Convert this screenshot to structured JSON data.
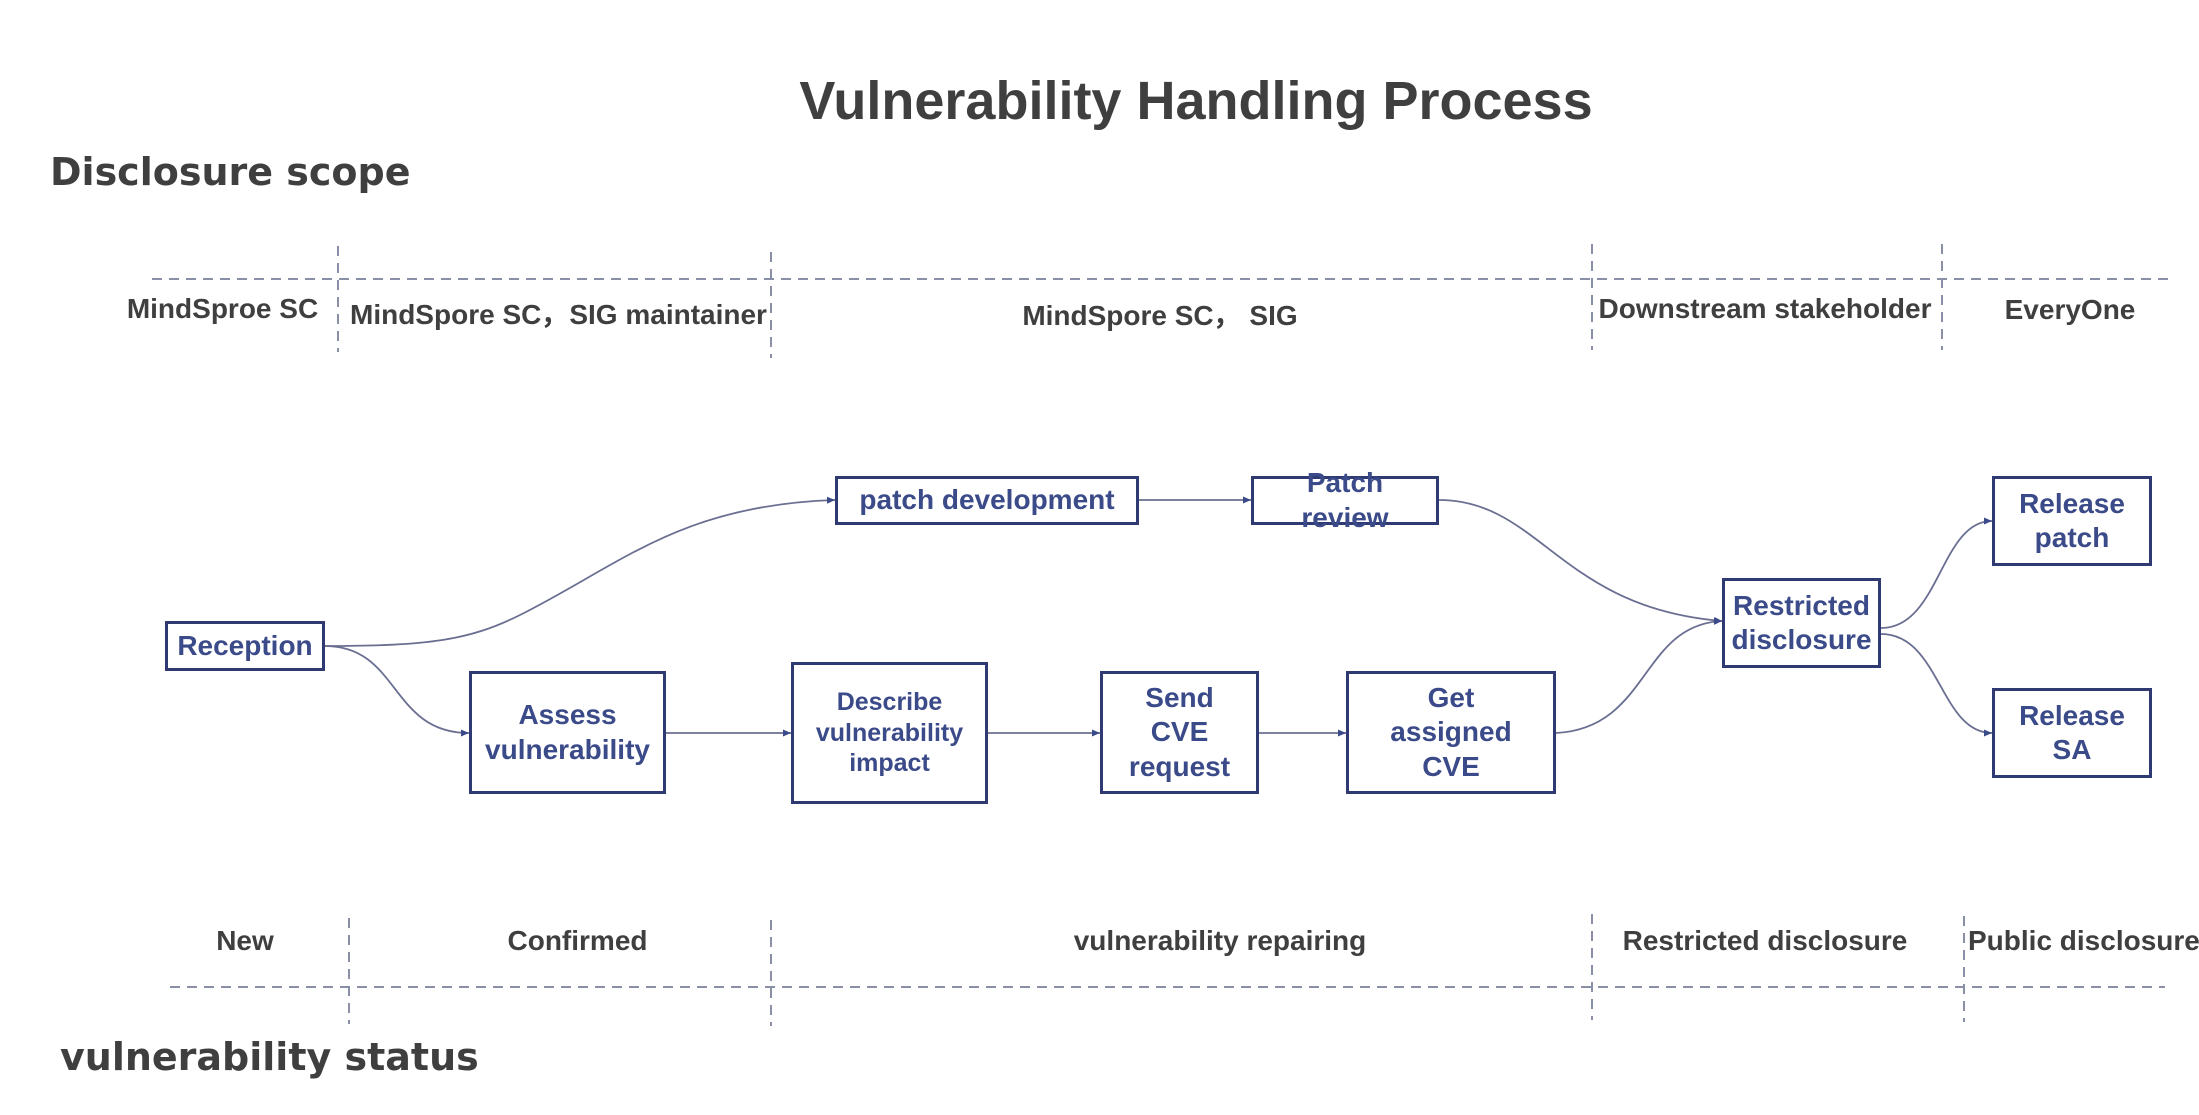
{
  "title": "Vulnerability Handling Process",
  "disclosure_scope": {
    "heading": "Disclosure scope",
    "columns": [
      "MindSproe SC",
      "MindSpore SC，SIG maintainer",
      "MindSpore SC，  SIG",
      "Downstream stakeholder",
      "EveryOne"
    ]
  },
  "vulnerability_status": {
    "heading": "vulnerability status",
    "columns": [
      "New",
      "Confirmed",
      "vulnerability repairing",
      "Restricted disclosure",
      "Public disclosure"
    ]
  },
  "nodes": {
    "reception": "Reception",
    "patch_development": "patch development",
    "patch_review": "Patch review",
    "assess_vulnerability": "Assess vulnerability",
    "describe_impact": "Describe vulnerability impact",
    "send_cve_request": "Send CVE request",
    "get_assigned_cve": "Get assigned CVE",
    "restricted_disclosure": "Restricted disclosure",
    "release_patch": "Release patch",
    "release_sa": "Release SA"
  },
  "colors": {
    "node_border": "#2f3a73",
    "node_text": "#3b4a88",
    "connector": "#6a6f92",
    "divider": "#8a8fa8",
    "label_text": "#3f3f3f"
  }
}
